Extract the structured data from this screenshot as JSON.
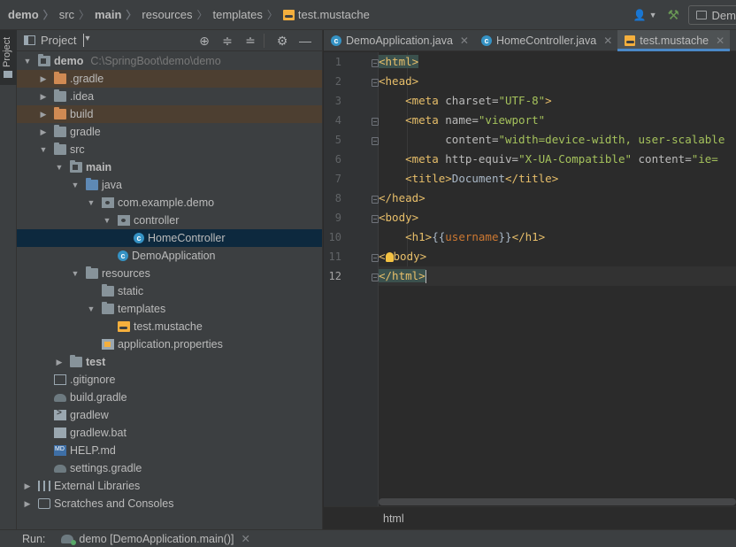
{
  "navbar": {
    "crumbs": [
      "demo",
      "src",
      "main",
      "resources",
      "templates",
      "test.mustache"
    ],
    "run_config_label": "Dem"
  },
  "tool_strip": {
    "project_tab_label": "Project"
  },
  "project_panel": {
    "title": "Project",
    "tree": [
      {
        "label": "demo",
        "path": "C:\\SpringBoot\\demo\\demo"
      },
      {
        "label": ".gradle"
      },
      {
        "label": ".idea"
      },
      {
        "label": "build"
      },
      {
        "label": "gradle"
      },
      {
        "label": "src"
      },
      {
        "label": "main"
      },
      {
        "label": "java"
      },
      {
        "label": "com.example.demo"
      },
      {
        "label": "controller"
      },
      {
        "label": "HomeController"
      },
      {
        "label": "DemoApplication"
      },
      {
        "label": "resources"
      },
      {
        "label": "static"
      },
      {
        "label": "templates"
      },
      {
        "label": "test.mustache"
      },
      {
        "label": "application.properties"
      },
      {
        "label": "test"
      },
      {
        "label": ".gitignore"
      },
      {
        "label": "build.gradle"
      },
      {
        "label": "gradlew"
      },
      {
        "label": "gradlew.bat"
      },
      {
        "label": "HELP.md"
      },
      {
        "label": "settings.gradle"
      },
      {
        "label": "External Libraries"
      },
      {
        "label": "Scratches and Consoles"
      }
    ]
  },
  "editor": {
    "tabs": [
      {
        "label": "DemoApplication.java",
        "active": false
      },
      {
        "label": "HomeController.java",
        "active": false
      },
      {
        "label": "test.mustache",
        "active": true
      }
    ],
    "line_numbers": [
      "1",
      "2",
      "3",
      "4",
      "5",
      "6",
      "7",
      "8",
      "9",
      "10",
      "11",
      "12"
    ],
    "code": {
      "l1_tag": "<html>",
      "l2_tag": "<head>",
      "l3_open": "<meta",
      "l3_attr": " charset=",
      "l3_val": "\"UTF-8\"",
      "l3_close": ">",
      "l4_open": "<meta",
      "l4_attr": " name=",
      "l4_val": "\"viewport\"",
      "l5_attr": "content=",
      "l5_val": "\"width=device-width, user-scalable",
      "l6_open": "<meta",
      "l6_attr": " http-equiv=",
      "l6_val": "\"X-UA-Compatible\"",
      "l6_attr2": " content=",
      "l6_val2": "\"ie=",
      "l7_open": "<title>",
      "l7_text": "Document",
      "l7_close": "</title>",
      "l8_tag": "</head>",
      "l9_tag": "<body>",
      "l10_open": "<h1>",
      "l10_brace_open": "{{",
      "l10_var": "username",
      "l10_brace_close": "}}",
      "l10_close": "</h1>",
      "l11_tag_end": "body>",
      "l12_tag": "</html>"
    },
    "breadcrumb": "html"
  },
  "runbar": {
    "label": "Run:",
    "config": "demo [DemoApplication.main()]"
  }
}
